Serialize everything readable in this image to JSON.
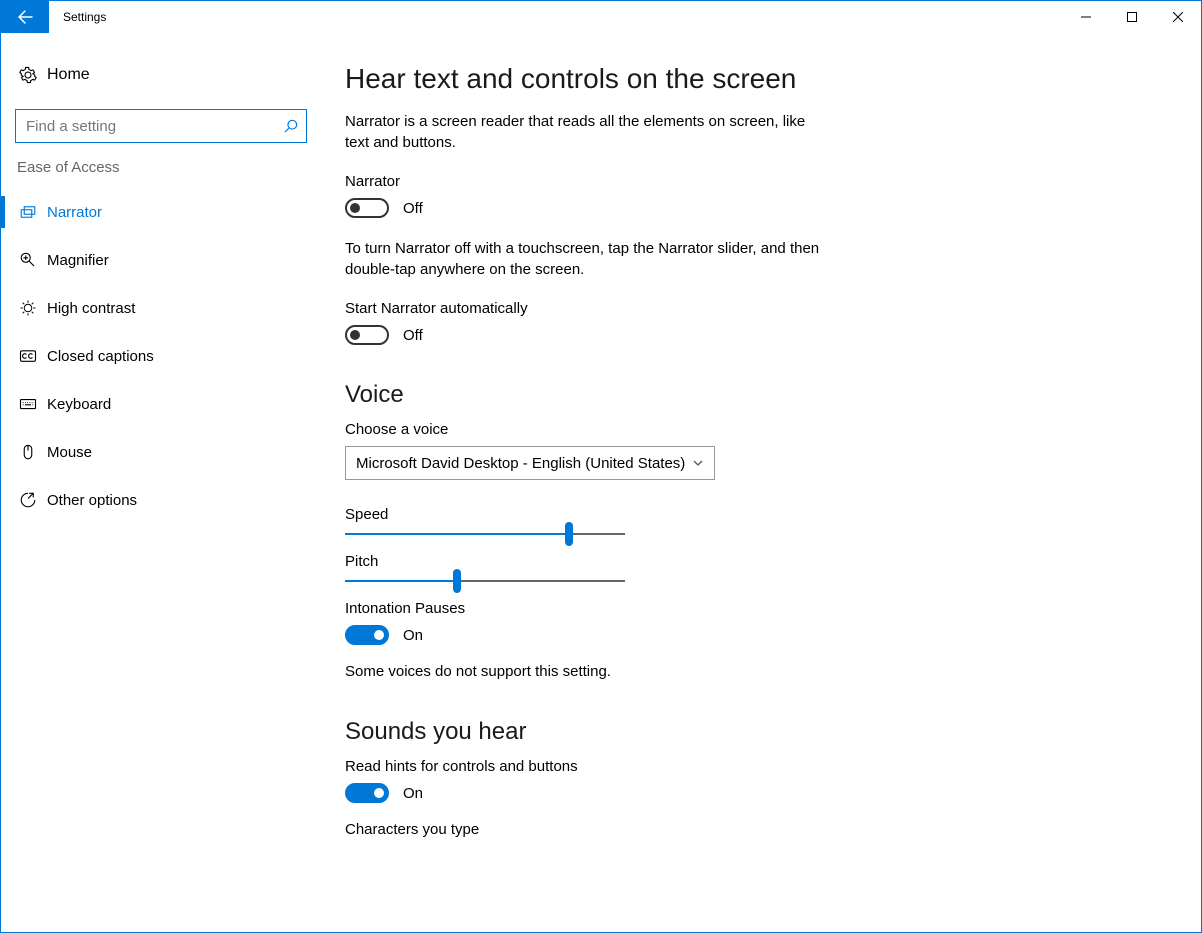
{
  "window": {
    "title": "Settings"
  },
  "sidebar": {
    "home_label": "Home",
    "search_placeholder": "Find a setting",
    "category": "Ease of Access",
    "items": [
      {
        "label": "Narrator"
      },
      {
        "label": "Magnifier"
      },
      {
        "label": "High contrast"
      },
      {
        "label": "Closed captions"
      },
      {
        "label": "Keyboard"
      },
      {
        "label": "Mouse"
      },
      {
        "label": "Other options"
      }
    ]
  },
  "main": {
    "h1": "Hear text and controls on the screen",
    "intro": "Narrator is a screen reader that reads all the elements on screen, like text and buttons.",
    "narrator_label": "Narrator",
    "narrator_state": "Off",
    "touch_off_note": "To turn Narrator off with a touchscreen, tap the Narrator slider, and then double-tap anywhere on the screen.",
    "auto_label": "Start Narrator automatically",
    "auto_state": "Off",
    "voice_h2": "Voice",
    "choose_voice_label": "Choose a voice",
    "voice_selected": "Microsoft David Desktop - English (United States)",
    "speed_label": "Speed",
    "speed_pct": 80,
    "pitch_label": "Pitch",
    "pitch_pct": 40,
    "intonation_label": "Intonation Pauses",
    "intonation_state": "On",
    "intonation_note": "Some voices do not support this setting.",
    "sounds_h2": "Sounds you hear",
    "hints_label": "Read hints for controls and buttons",
    "hints_state": "On",
    "chars_label": "Characters you type"
  },
  "colors": {
    "accent": "#0078d7"
  }
}
